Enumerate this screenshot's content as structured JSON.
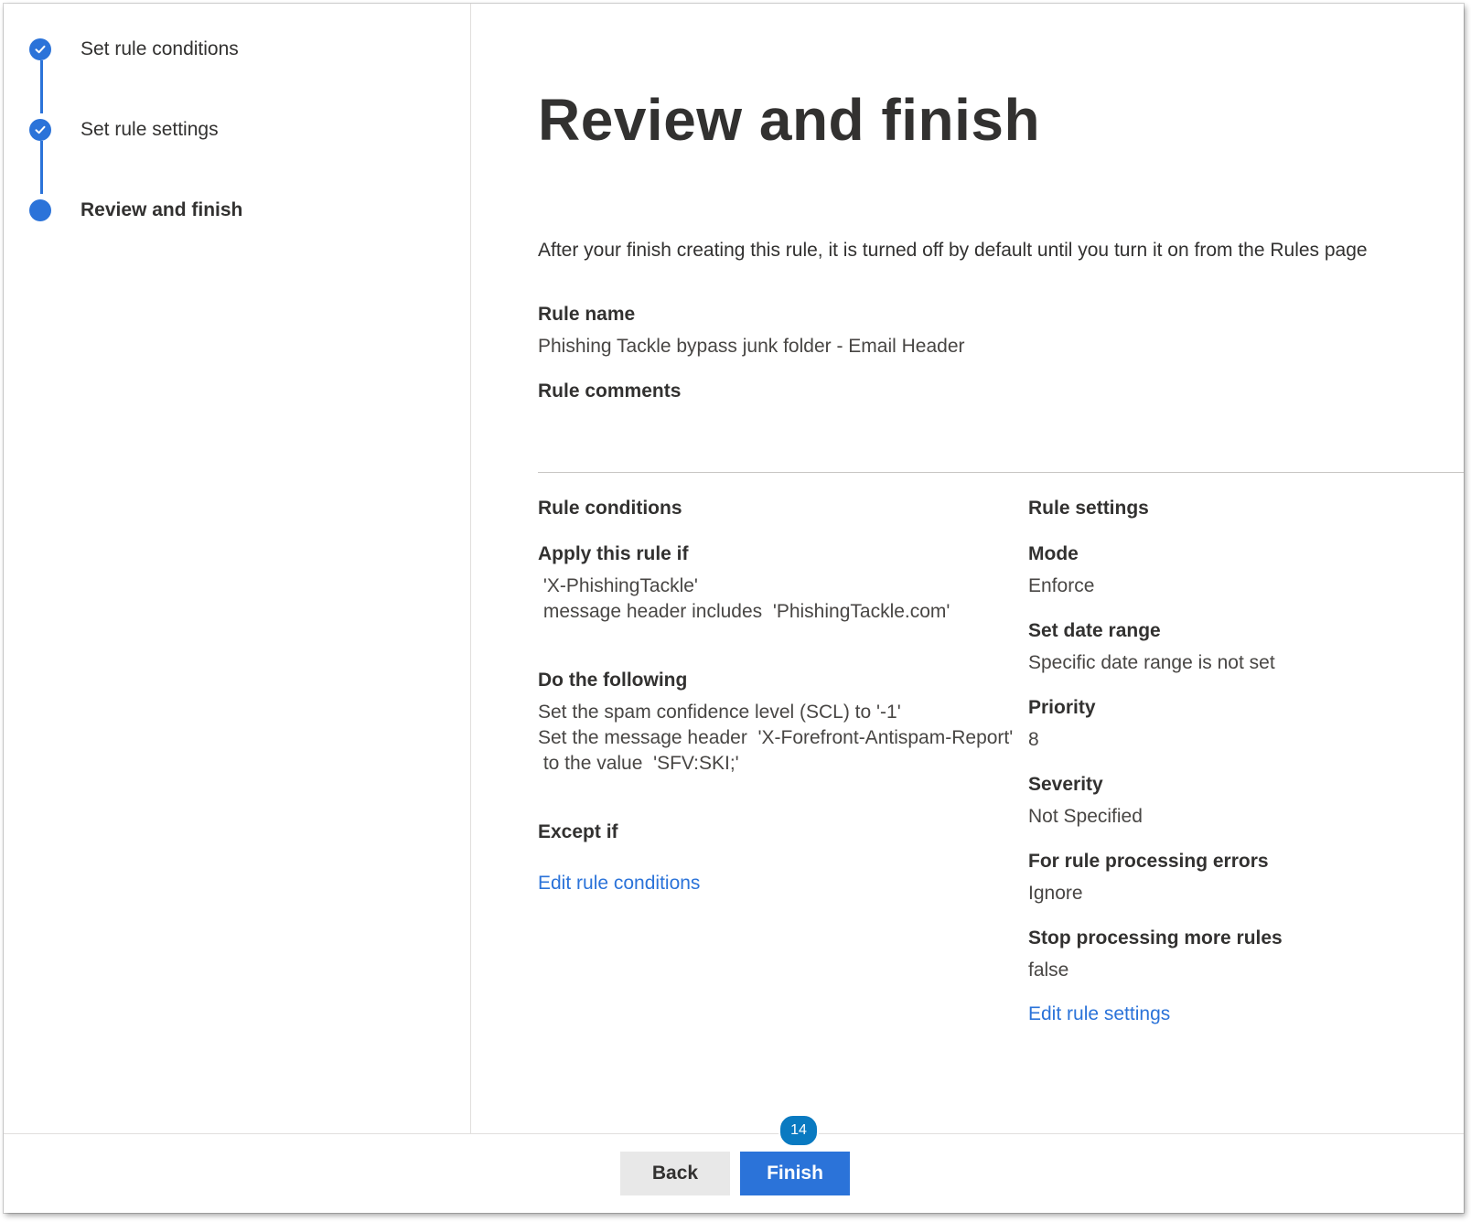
{
  "colors": {
    "accent": "#2b73d9",
    "badge": "#0a7ac1"
  },
  "steps": [
    {
      "label": "Set rule conditions",
      "state": "completed",
      "icon": "checkmark-icon"
    },
    {
      "label": "Set rule settings",
      "state": "completed",
      "icon": "checkmark-icon"
    },
    {
      "label": "Review and finish",
      "state": "current",
      "icon": "circle-icon"
    }
  ],
  "main": {
    "title": "Review and finish",
    "info": "After your finish creating this rule, it is turned off by default until you turn it on from the Rules page",
    "rule_name_label": "Rule name",
    "rule_name_value": "Phishing Tackle bypass junk folder - Email Header",
    "rule_comments_label": "Rule comments",
    "conditions": {
      "title": "Rule conditions",
      "apply_label": "Apply this rule if",
      "apply_lines": [
        " 'X-PhishingTackle'",
        " message header includes  'PhishingTackle.com'"
      ],
      "do_label": "Do the following",
      "do_lines": [
        "Set the spam confidence level (SCL) to '-1'",
        "Set the message header  'X-Forefront-Antispam-Report'",
        " to the value  'SFV:SKI;'"
      ],
      "except_label": "Except if",
      "edit_link": "Edit rule conditions"
    },
    "settings": {
      "title": "Rule settings",
      "mode_label": "Mode",
      "mode_value": "Enforce",
      "date_label": "Set date range",
      "date_value": "Specific date range is not set",
      "priority_label": "Priority",
      "priority_value": "8",
      "severity_label": "Severity",
      "severity_value": "Not Specified",
      "errors_label": "For rule processing errors",
      "errors_value": "Ignore",
      "stop_label": "Stop processing more rules",
      "stop_value": "false",
      "edit_link": "Edit rule settings"
    }
  },
  "footer": {
    "back_label": "Back",
    "finish_label": "Finish",
    "badge": "14"
  }
}
